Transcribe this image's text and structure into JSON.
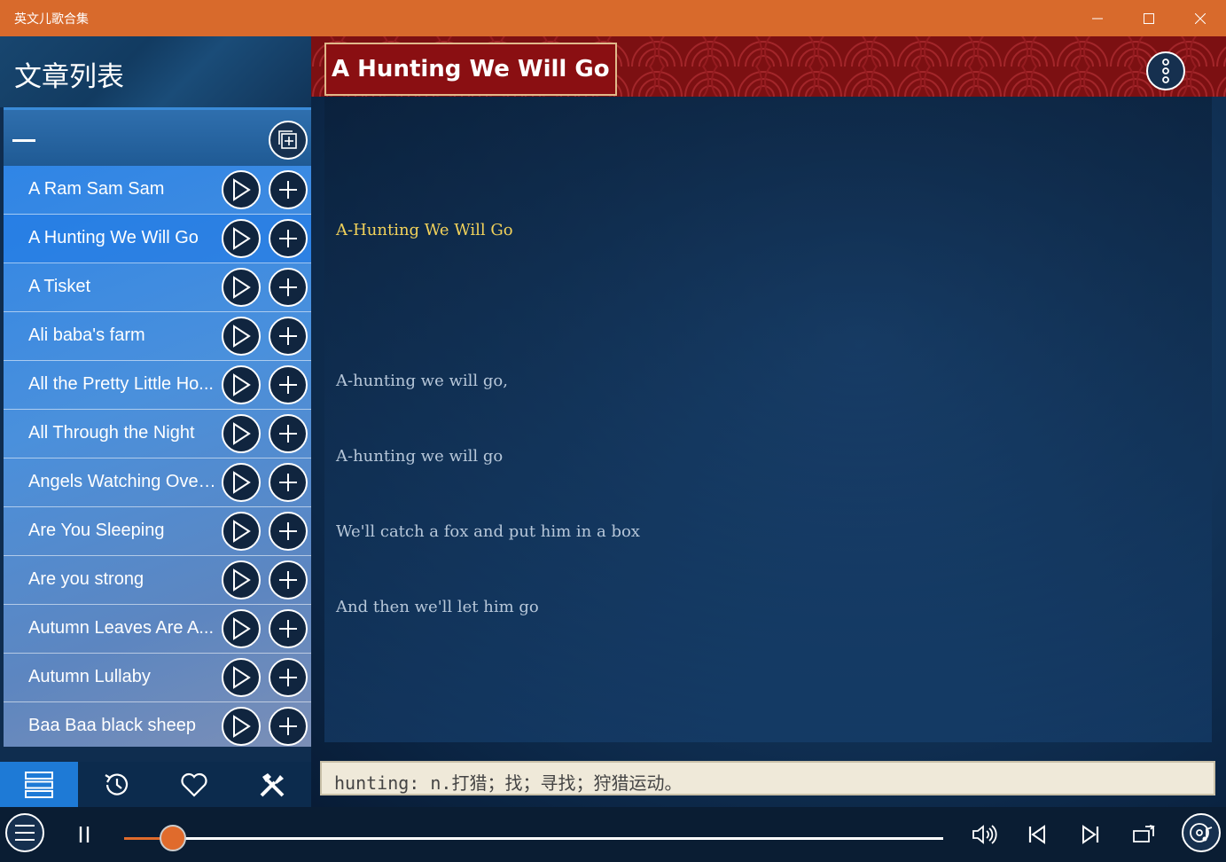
{
  "window": {
    "title": "英文儿歌合集"
  },
  "sidebar": {
    "title": "文章列表",
    "songs": [
      "A Ram Sam Sam",
      "A Hunting We Will Go",
      "A Tisket",
      "Ali baba's farm",
      "All the Pretty Little Ho...",
      "All Through the Night",
      "Angels Watching Over...",
      "Are You Sleeping",
      "Are you strong",
      "Autumn Leaves Are A...",
      "Autumn Lullaby",
      "Baa Baa black sheep"
    ],
    "active_index": 1,
    "tabs": [
      "list-icon",
      "history-icon",
      "heart-icon",
      "tools-icon"
    ],
    "active_tab": 0
  },
  "main": {
    "song_title": "A Hunting We Will Go",
    "lyrics": [
      "A-Hunting We Will Go",
      "A-hunting we will go,",
      "A-hunting we will go",
      "We'll catch a fox and put him in a box",
      "And then we'll let him go"
    ],
    "current_lyric_index": 0,
    "dictionary": "hunting: n.打猎；找；寻找；狩猎运动。"
  },
  "player": {
    "progress": 0.06,
    "accent": "#e06b2c"
  },
  "colors": {
    "titlebar": "#d86a2c",
    "header": "#7c1012",
    "lyric_current": "#f2d25a"
  }
}
